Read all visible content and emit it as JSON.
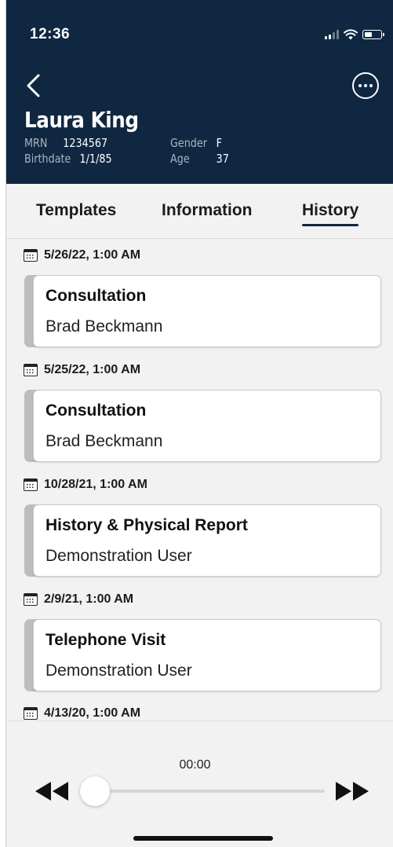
{
  "status_bar": {
    "time": "12:36"
  },
  "patient": {
    "name": "Laura King",
    "mrn_label": "MRN",
    "mrn": "1234567",
    "gender_label": "Gender",
    "gender": "F",
    "birthdate_label": "Birthdate",
    "birthdate": "1/1/85",
    "age_label": "Age",
    "age": "37"
  },
  "tabs": [
    {
      "label": "Templates",
      "active": false
    },
    {
      "label": "Information",
      "active": false
    },
    {
      "label": "History",
      "active": true
    }
  ],
  "history": [
    {
      "date": "5/26/22, 1:00 AM",
      "title": "Consultation",
      "author": "Brad Beckmann"
    },
    {
      "date": "5/25/22, 1:00 AM",
      "title": "Consultation",
      "author": "Brad Beckmann"
    },
    {
      "date": "10/28/21, 1:00 AM",
      "title": "History & Physical Report",
      "author": "Demonstration User"
    },
    {
      "date": "2/9/21, 1:00 AM",
      "title": "Telephone Visit",
      "author": "Demonstration User"
    },
    {
      "date": "4/13/20, 1:00 AM",
      "title": "",
      "author": ""
    }
  ],
  "player": {
    "time": "00:00",
    "progress": 0
  },
  "colors": {
    "header_bg": "#0f2741",
    "accent": "#0f2741"
  }
}
